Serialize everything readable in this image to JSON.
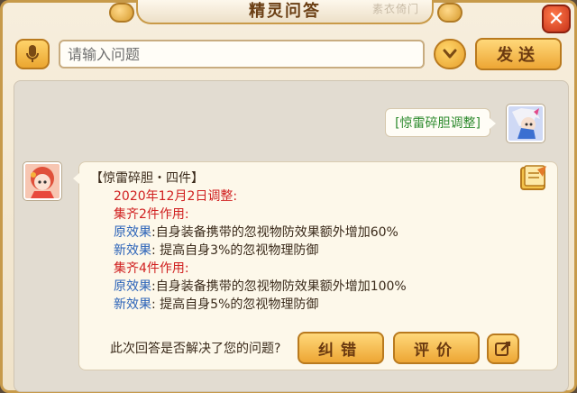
{
  "window": {
    "title": "精灵问答",
    "title_decoration": "素衣倚门",
    "close_glyph": "✕"
  },
  "input_row": {
    "placeholder": "请输入问题",
    "send_label": "发送"
  },
  "chat": {
    "user_message": "[惊雷碎胆调整]",
    "answer": {
      "heading": "【惊雷碎胆・四件】",
      "date_line": "2020年12月2日调整:",
      "set2_title": "集齐2件作用:",
      "set2_old_label": "原效果",
      "set2_old_text": ":自身装备携带的忽视物防效果额外增加60%",
      "set2_new_label": "新效果",
      "set2_new_text": ": 提高自身3%的忽视物理防御",
      "set4_title": "集齐4件作用:",
      "set4_old_label": "原效果",
      "set4_old_text": ":自身装备携带的忽视物防效果额外增加100%",
      "set4_new_label": "新效果",
      "set4_new_text": ": 提高自身5%的忽视物理防御"
    },
    "feedback": {
      "question": "此次回答是否解决了您的问题?",
      "correct_label": "纠错",
      "rate_label": "评价"
    }
  },
  "colors": {
    "accent_gold": "#eda634",
    "answer_red": "#d02020",
    "answer_blue": "#2a62b8",
    "user_text_green": "#2d8a2d"
  },
  "icons": [
    "microphone-icon",
    "chevron-down-icon",
    "close-icon",
    "book-icon",
    "edit-icon",
    "user-avatar",
    "bot-avatar"
  ]
}
